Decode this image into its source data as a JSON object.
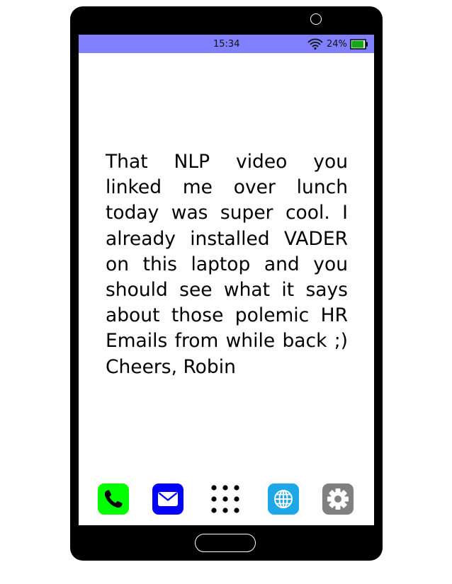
{
  "status_bar": {
    "time": "15:34",
    "battery_percent": "24%",
    "battery_level": 0.24,
    "color": "#8080ff"
  },
  "message": {
    "text": "That NLP video you linked me over lunch today was super cool.  I already in­stalled VADER on this lap­top and you should see what it says about those polemic HR Emails from while back ;) Cheers, Robin"
  },
  "dock": {
    "icons": [
      {
        "name": "phone-icon",
        "color": "#00ff00"
      },
      {
        "name": "mail-icon",
        "color": "#0000ff"
      },
      {
        "name": "app-grid-icon",
        "color": "#000000"
      },
      {
        "name": "browser-icon",
        "color": "#1ea7e6"
      },
      {
        "name": "settings-icon",
        "color": "#808080"
      }
    ]
  }
}
